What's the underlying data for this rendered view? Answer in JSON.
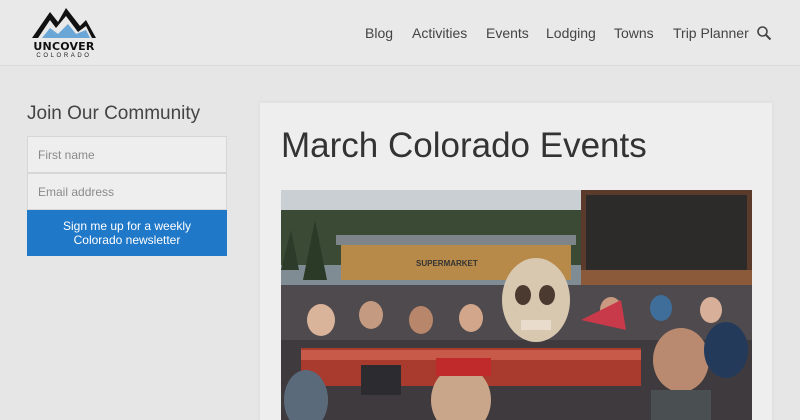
{
  "header": {
    "logo_text": "UNCOVER",
    "logo_subtext": "COLORADO",
    "nav": [
      "Blog",
      "Activities",
      "Events",
      "Lodging",
      "Towns",
      "Trip Planner"
    ],
    "search_icon": "search-icon"
  },
  "sidebar": {
    "title": "Join Our Community",
    "first_name_placeholder": "First name",
    "email_placeholder": "Email address",
    "signup_label": "Sign me up for a weekly Colorado newsletter"
  },
  "main": {
    "title": "March Colorado Events",
    "photo": {
      "sign_text": "SUPERMARKET"
    }
  },
  "colors": {
    "accent": "#1f78c8",
    "background": "#e6e6e6"
  }
}
